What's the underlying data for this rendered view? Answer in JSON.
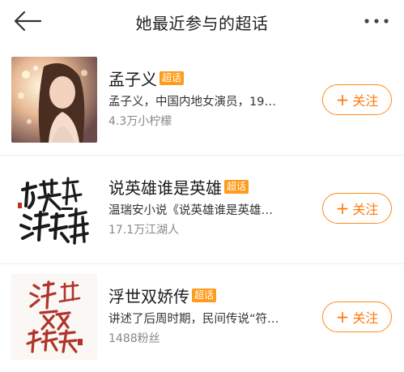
{
  "header": {
    "title": "她最近参与的超话"
  },
  "badge_label": "超话",
  "items": [
    {
      "name": "孟子义",
      "desc": "孟子义，中国内地女演员，19…",
      "stat": "4.3万小柠檬",
      "follow_label": "关注"
    },
    {
      "name": "说英雄谁是英雄",
      "desc": "温瑞安小说《说英雄谁是英雄…",
      "stat": "17.1万江湖人",
      "follow_label": "关注"
    },
    {
      "name": "浮世双娇传",
      "desc": "讲述了后周时期，民间传说“符…",
      "stat": "1488粉丝",
      "follow_label": "关注"
    }
  ],
  "colors": {
    "accent": "#ff8c1a",
    "badge": "#ff9b1a",
    "poster_red": "#b0342a"
  }
}
